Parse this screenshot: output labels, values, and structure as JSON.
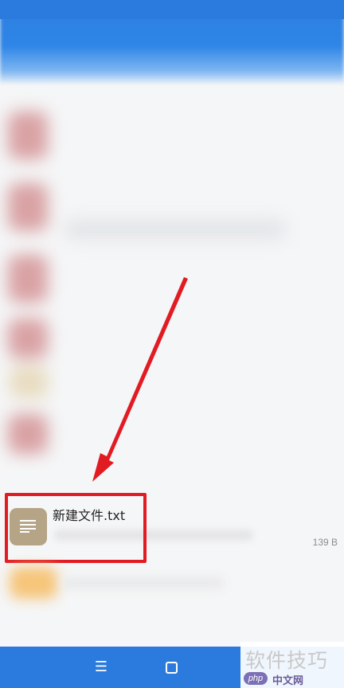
{
  "file_list": {
    "highlighted_item": {
      "name": "新建文件.txt",
      "size": "139 B",
      "icon": "text-document-icon"
    }
  },
  "nav_bar": {
    "menu_icon": "menu-icon",
    "home_icon": "home-square-icon",
    "menu_glyph": "☰"
  },
  "watermark": {
    "main_text": "软件技巧",
    "badge": "php",
    "site": "中文网"
  },
  "colors": {
    "accent_blue": "#2a7bdd",
    "highlight_red": "#e21b23",
    "file_icon_bg": "#b5a486"
  }
}
